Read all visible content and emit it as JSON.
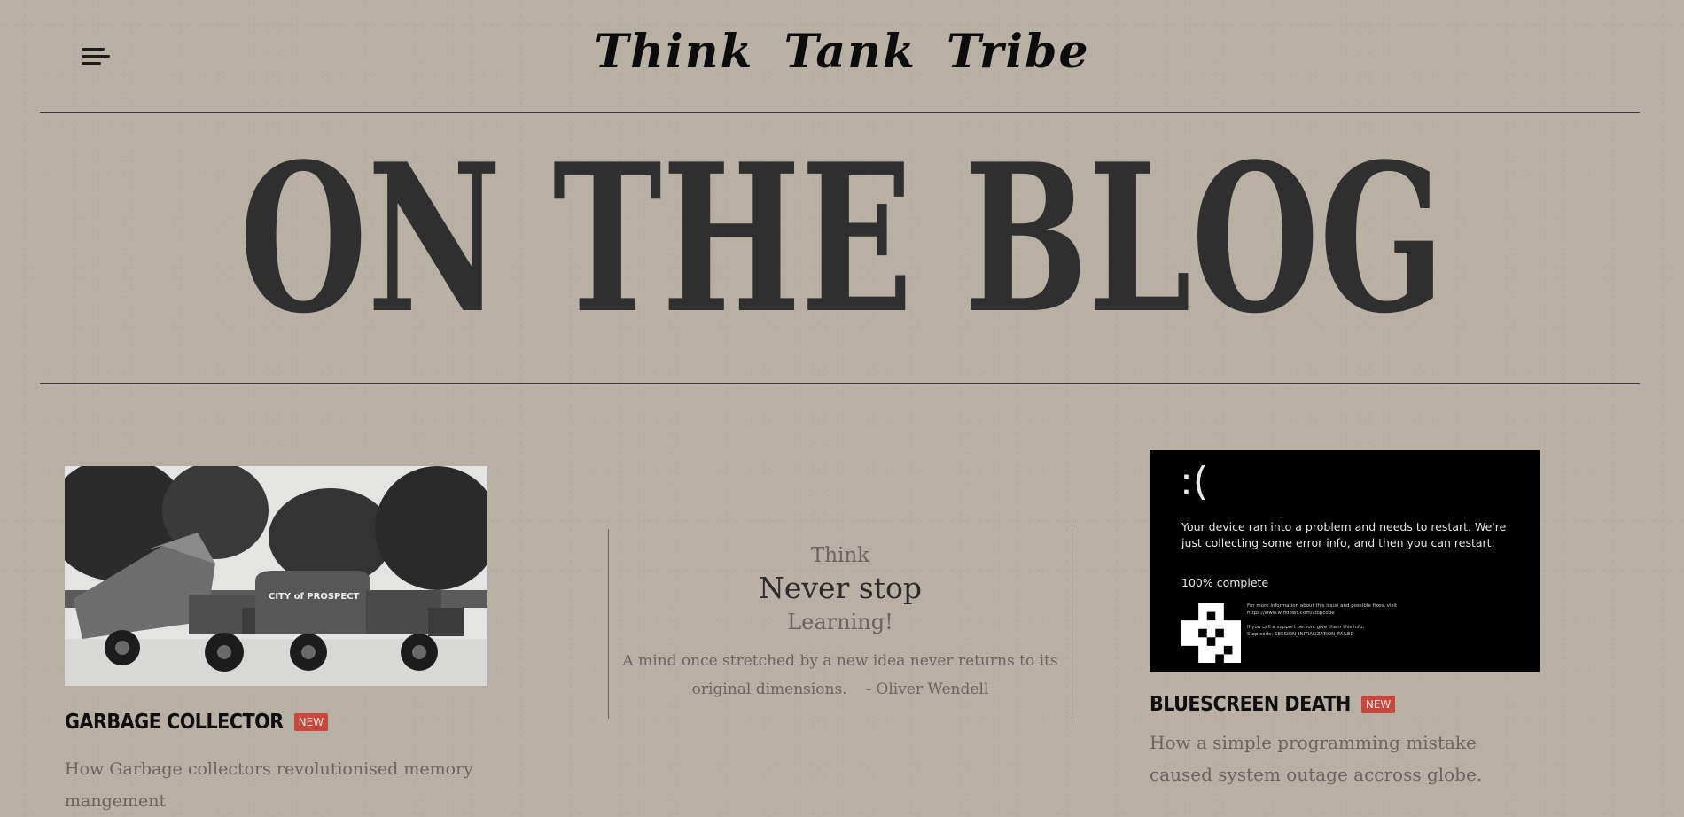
{
  "header": {
    "brand": "Think Tank Tribe",
    "menu_icon": "hamburger-menu-icon"
  },
  "hero": {
    "title": "ON THE BLOG"
  },
  "posts": [
    {
      "title": "GARBAGE COLLECTOR",
      "badge": "NEW",
      "description": "How Garbage collectors revolutionised memory mangement",
      "image_text": "CITY of PROSPECT"
    },
    {
      "title": "BLUESCREEN DEATH",
      "badge": "NEW",
      "description": "How a simple programming mistake caused system outage accross globe.",
      "image": {
        "face": ":(",
        "message": "Your device ran into a problem and needs to restart. We're just collecting some error info, and then you can restart.",
        "percent": "100% complete",
        "info1": "For more information about this issue and possible fixes, visit",
        "info2": "https://www.windows.com/stopcode",
        "info3": "If you call a support person, give them this info:",
        "info4": "Stop code: SESSION_INITIALIZATION_FAILED"
      }
    }
  ],
  "quote": {
    "line1": "Think",
    "line2": "Never stop",
    "line3": "Learning!",
    "text": "A mind once stretched by a new idea never returns to its original dimensions.",
    "author": "- Oliver Wendell"
  },
  "colors": {
    "background": "#b9b0a4",
    "badge": "#c8463c",
    "text_dark": "#2c2c2c",
    "text_muted": "#6a655e"
  }
}
